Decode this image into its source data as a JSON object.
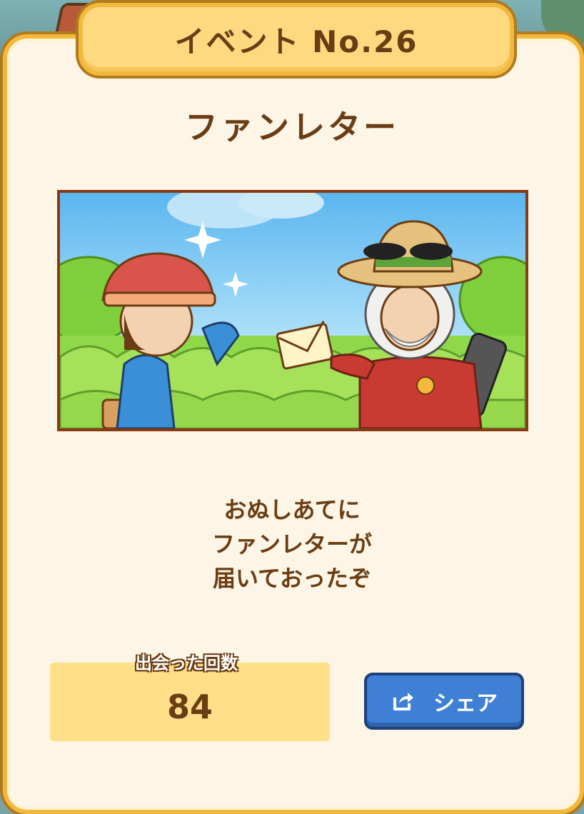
{
  "header": {
    "event_title": "イベント No.26"
  },
  "event": {
    "name": "ファンレター"
  },
  "message": {
    "lines": [
      "おぬしあてに",
      "ファンレターが",
      "届いておったぞ"
    ]
  },
  "stats": {
    "encounter_label": "出会った回数",
    "encounter_count": "84"
  },
  "share": {
    "label": "シェア",
    "icon": "share-icon"
  },
  "colors": {
    "frame": "#f2b93d",
    "panel": "#fdf6e6",
    "text": "#6b3d14",
    "share_button": "#3f7fd6"
  }
}
